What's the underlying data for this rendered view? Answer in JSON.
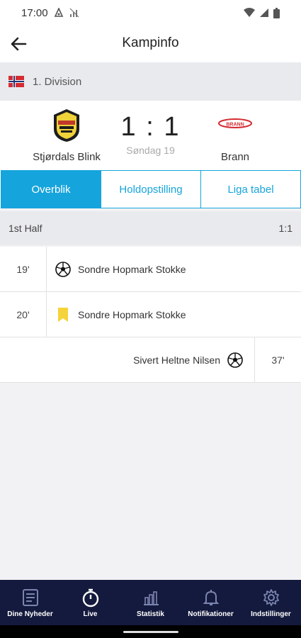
{
  "status": {
    "time": "17:00"
  },
  "appbar": {
    "title": "Kampinfo"
  },
  "league": {
    "name": "1. Division"
  },
  "match": {
    "home_team": "Stjørdals Blink",
    "away_team": "Brann",
    "score": "1 : 1",
    "date": "Søndag 19",
    "away_logo_text": "BRANN"
  },
  "tabs": [
    "Overblik",
    "Holdopstilling",
    "Liga tabel"
  ],
  "half": {
    "label": "1st Half",
    "score": "1:1"
  },
  "events": [
    {
      "minute": "19'",
      "type": "goal",
      "player": "Sondre Hopmark Stokke",
      "side": "home"
    },
    {
      "minute": "20'",
      "type": "yellow-card",
      "player": "Sondre Hopmark Stokke",
      "side": "home"
    },
    {
      "minute": "37'",
      "type": "goal",
      "player": "Sivert Heltne Nilsen",
      "side": "away"
    }
  ],
  "bottom_nav": [
    "Dine Nyheder",
    "Live",
    "Statistik",
    "Notifikationer",
    "Indstillinger"
  ],
  "colors": {
    "accent": "#16a4dc",
    "nav_bg": "#141a3d",
    "yellow_card": "#f5d33a"
  }
}
